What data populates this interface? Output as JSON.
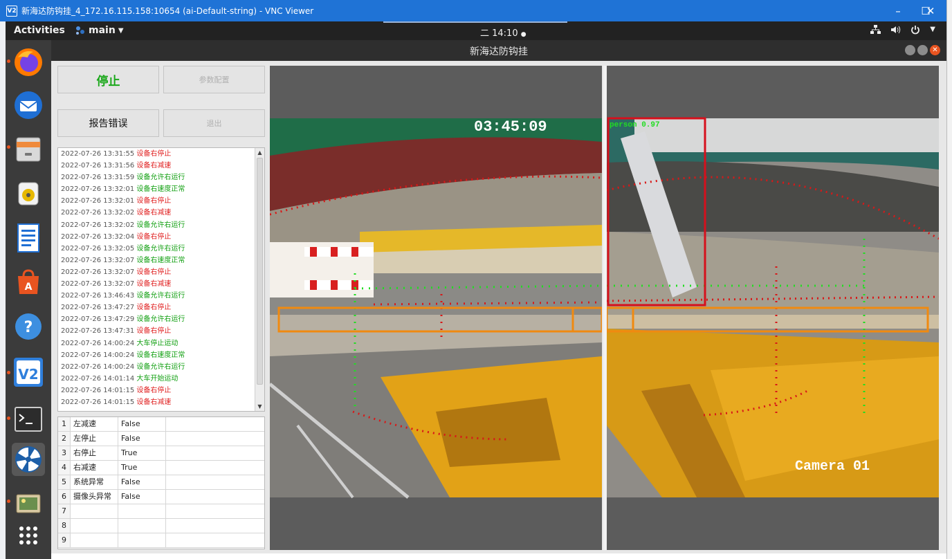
{
  "vnc": {
    "logo": "V2",
    "title": "新海达防钩挂_4_172.16.115.158:10654 (ai-Default-string) - VNC Viewer",
    "minimize": "–",
    "maximize": "☐",
    "close": "✕"
  },
  "topbar": {
    "activities": "Activities",
    "app_menu": "main",
    "clock": "二 14:10",
    "tray": [
      "network-icon",
      "volume-icon",
      "power-icon"
    ]
  },
  "dock": {
    "items": [
      "firefox-icon",
      "thunderbird-icon",
      "files-icon",
      "rhythmbox-icon",
      "writer-icon",
      "software-icon",
      "help-icon",
      "vnc-viewer-icon",
      "terminal-icon",
      "app-icon",
      "image-viewer-icon",
      "show-apps-icon"
    ]
  },
  "app": {
    "title": "新海达防钩挂",
    "buttons": {
      "stop": "停止",
      "config": "参数配置",
      "report": "报告错误",
      "exit": "退出"
    },
    "log": [
      {
        "ts": "2022-07-26 13:31:55",
        "msg": "设备右停止",
        "color": "red"
      },
      {
        "ts": "2022-07-26 13:31:56",
        "msg": "设备右减速",
        "color": "red"
      },
      {
        "ts": "2022-07-26 13:31:59",
        "msg": "设备允许右运行",
        "color": "green"
      },
      {
        "ts": "2022-07-26 13:32:01",
        "msg": "设备右速度正常",
        "color": "green"
      },
      {
        "ts": "2022-07-26 13:32:01",
        "msg": "设备右停止",
        "color": "red"
      },
      {
        "ts": "2022-07-26 13:32:02",
        "msg": "设备右减速",
        "color": "red"
      },
      {
        "ts": "2022-07-26 13:32:02",
        "msg": "设备允许右运行",
        "color": "green"
      },
      {
        "ts": "2022-07-26 13:32:04",
        "msg": "设备右停止",
        "color": "red"
      },
      {
        "ts": "2022-07-26 13:32:05",
        "msg": "设备允许右运行",
        "color": "green"
      },
      {
        "ts": "2022-07-26 13:32:07",
        "msg": "设备右速度正常",
        "color": "green"
      },
      {
        "ts": "2022-07-26 13:32:07",
        "msg": "设备右停止",
        "color": "red"
      },
      {
        "ts": "2022-07-26 13:32:07",
        "msg": "设备右减速",
        "color": "red"
      },
      {
        "ts": "2022-07-26 13:46:43",
        "msg": "设备允许右运行",
        "color": "green"
      },
      {
        "ts": "2022-07-26 13:47:27",
        "msg": "设备右停止",
        "color": "red"
      },
      {
        "ts": "2022-07-26 13:47:29",
        "msg": "设备允许右运行",
        "color": "green"
      },
      {
        "ts": "2022-07-26 13:47:31",
        "msg": "设备右停止",
        "color": "red"
      },
      {
        "ts": "2022-07-26 14:00:24",
        "msg": "大车停止运动",
        "color": "green"
      },
      {
        "ts": "2022-07-26 14:00:24",
        "msg": "设备右速度正常",
        "color": "green"
      },
      {
        "ts": "2022-07-26 14:00:24",
        "msg": "设备允许右运行",
        "color": "green"
      },
      {
        "ts": "2022-07-26 14:01:14",
        "msg": "大车开始运动",
        "color": "green"
      },
      {
        "ts": "2022-07-26 14:01:15",
        "msg": "设备右停止",
        "color": "red"
      },
      {
        "ts": "2022-07-26 14:01:15",
        "msg": "设备右减速",
        "color": "red"
      }
    ],
    "status_table": [
      {
        "idx": "1",
        "name": "左减速",
        "value": "False"
      },
      {
        "idx": "2",
        "name": "左停止",
        "value": "False"
      },
      {
        "idx": "3",
        "name": "右停止",
        "value": "True"
      },
      {
        "idx": "4",
        "name": "右减速",
        "value": "True"
      },
      {
        "idx": "5",
        "name": "系统异常",
        "value": "False"
      },
      {
        "idx": "6",
        "name": "摄像头异常",
        "value": "False"
      },
      {
        "idx": "7",
        "name": "",
        "value": ""
      },
      {
        "idx": "8",
        "name": "",
        "value": ""
      },
      {
        "idx": "9",
        "name": "",
        "value": ""
      }
    ],
    "camera": {
      "timestamp": "03:45:09",
      "detection_label": "person 0.97",
      "camera_label": "Camera 01"
    }
  },
  "colors": {
    "log_red": "#e02020",
    "log_green": "#12a012",
    "detection_red": "#d6101c",
    "zone_orange": "#f08a10",
    "zone_green": "#22dd22"
  }
}
